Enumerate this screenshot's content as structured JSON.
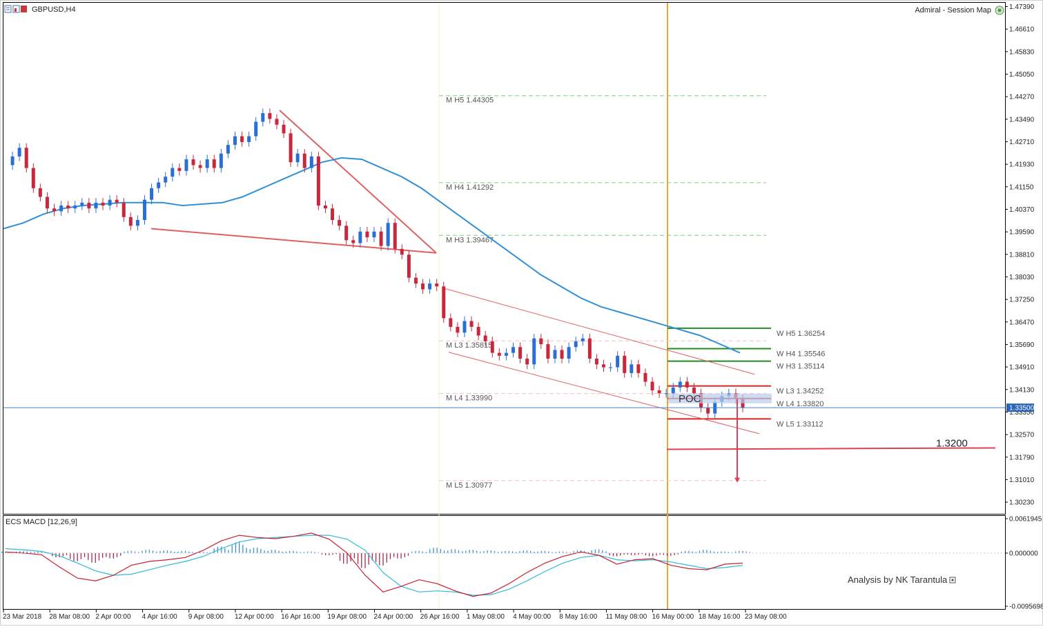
{
  "window": {
    "symbol_timeframe": "GBPUSD,H4",
    "session_map_label": "Admiral - Session Map",
    "analysis_credit": "Analysis by NK Tarantula"
  },
  "chart_data": [
    {
      "type": "candlestick",
      "title": "GBPUSD,H4",
      "x_tick_labels": [
        "23 Mar 2018",
        "28 Mar 08:00",
        "2 Apr 00:00",
        "4 Apr 16:00",
        "9 Apr 08:00",
        "12 Apr 00:00",
        "16 Apr 16:00",
        "19 Apr 08:00",
        "24 Apr 00:00",
        "26 Apr 16:00",
        "1 May 08:00",
        "4 May 00:00",
        "8 May 16:00",
        "11 May 08:00",
        "16 May 00:00",
        "18 May 16:00",
        "23 May 08:00"
      ],
      "y_tick_labels": [
        "1.47390",
        "1.46610",
        "1.45830",
        "1.45050",
        "1.44270",
        "1.43490",
        "1.42710",
        "1.41930",
        "1.41150",
        "1.40370",
        "1.39590",
        "1.38810",
        "1.38030",
        "1.37250",
        "1.36470",
        "1.35690",
        "1.34910",
        "1.34130",
        "1.33350",
        "1.32570",
        "1.31790",
        "1.31010",
        "1.30230"
      ],
      "ylim": [
        1.2985,
        1.4745
      ],
      "current_price": "1.33500",
      "price_path": [
        1.419,
        1.422,
        1.425,
        1.418,
        1.411,
        1.408,
        1.404,
        1.403,
        1.405,
        1.404,
        1.405,
        1.406,
        1.404,
        1.406,
        1.405,
        1.407,
        1.406,
        1.401,
        1.398,
        1.4,
        1.407,
        1.411,
        1.413,
        1.415,
        1.418,
        1.417,
        1.421,
        1.419,
        1.418,
        1.421,
        1.418,
        1.423,
        1.426,
        1.429,
        1.427,
        1.429,
        1.434,
        1.437,
        1.435,
        1.433,
        1.43,
        1.42,
        1.423,
        1.418,
        1.422,
        1.405,
        1.404,
        1.4,
        1.398,
        1.393,
        1.392,
        1.396,
        1.394,
        1.396,
        1.391,
        1.399,
        1.39,
        1.388,
        1.38,
        1.378,
        1.376,
        1.378,
        1.377,
        1.366,
        1.363,
        1.361,
        1.365,
        1.363,
        1.36,
        1.358,
        1.354,
        1.353,
        1.354,
        1.356,
        1.352,
        1.35,
        1.359,
        1.357,
        1.352,
        1.355,
        1.352,
        1.356,
        1.358,
        1.359,
        1.352,
        1.35,
        1.349,
        1.349,
        1.353,
        1.347,
        1.35,
        1.347,
        1.344,
        1.341,
        1.34,
        1.34,
        1.342,
        1.344,
        1.342,
        1.34,
        1.335,
        1.333,
        1.337,
        1.339,
        1.34,
        1.338,
        1.335
      ],
      "moving_average_path": [
        1.397,
        1.399,
        1.402,
        1.404,
        1.405,
        1.4055,
        1.406,
        1.406,
        1.406,
        1.405,
        1.4055,
        1.406,
        1.408,
        1.411,
        1.414,
        1.417,
        1.42,
        1.4215,
        1.421,
        1.418,
        1.415,
        1.411,
        1.406,
        1.401,
        1.396,
        1.391,
        1.386,
        1.381,
        1.377,
        1.373,
        1.37,
        1.368,
        1.366,
        1.364,
        1.362,
        1.36,
        1.357,
        1.354
      ],
      "monthly_levels": [
        {
          "label": "M  H5 1.44305",
          "value": 1.44305,
          "color": "#7ed07e"
        },
        {
          "label": "M  H4 1.41292",
          "value": 1.41292,
          "color": "#7ed07e"
        },
        {
          "label": "M  H3 1.39467",
          "value": 1.39467,
          "color": "#7ed07e"
        },
        {
          "label": "M  L3 1.35815",
          "value": 1.35815,
          "color": "#f0c0c0"
        },
        {
          "label": "M  L4 1.33990",
          "value": 1.3399,
          "color": "#f0c0c0"
        },
        {
          "label": "M  L5 1.30977",
          "value": 1.30977,
          "color": "#f0c0c0"
        }
      ],
      "weekly_levels": [
        {
          "label": "W  H5 1.36254",
          "value": 1.36254,
          "color": "#228b22"
        },
        {
          "label": "W  H4 1.35546",
          "value": 1.35546,
          "color": "#228b22"
        },
        {
          "label": "W  H3 1.35114",
          "value": 1.35114,
          "color": "#228b22"
        },
        {
          "label": "W  L3 1.34252",
          "value": 1.34252,
          "color": "#dd2222"
        },
        {
          "label": "W  L4 1.33820",
          "value": 1.3382,
          "color": "#dd2222"
        },
        {
          "label": "W  L5 1.33112",
          "value": 1.33112,
          "color": "#dd2222"
        }
      ],
      "annotations": {
        "poc_label": "POC",
        "target_label": "1.3200",
        "target_value": 1.3206
      }
    },
    {
      "type": "macd",
      "title": "ECS MACD [12,26,9]",
      "y_tick_labels": [
        "0.0061945",
        "0.000000",
        "-0.0095698"
      ],
      "ylim": [
        -0.0095698,
        0.0061945
      ],
      "histogram": [
        0.0003,
        0.0004,
        0.0003,
        -0.0008,
        -0.0015,
        -0.0018,
        -0.001,
        0.0004,
        0.0006,
        0.0005,
        0.0004,
        0.0002,
        0.0012,
        0.002,
        0.001,
        0.0006,
        0.0004,
        0.0003,
        -0.0004,
        -0.002,
        -0.0028,
        -0.0023,
        -0.001,
        0.0004,
        0.001,
        0.0007,
        0.0006,
        0.0005,
        0.0004,
        0.0005,
        0.0004,
        0.0003,
        0.0005,
        0.0007,
        -0.0006,
        -0.0004,
        -0.0006,
        -0.0005,
        0.0004,
        0.0006,
        0.0003,
        0.0004
      ],
      "macd_line": [
        0.0002,
        0.0,
        -0.0003,
        -0.0025,
        -0.0045,
        -0.005,
        -0.004,
        -0.0022,
        -0.0015,
        -0.0012,
        -0.0008,
        0.0005,
        0.0022,
        0.0032,
        0.0028,
        0.0026,
        0.003,
        0.0036,
        0.0025,
        0.0,
        -0.004,
        -0.007,
        -0.006,
        -0.0048,
        -0.0055,
        -0.0068,
        -0.0078,
        -0.0072,
        -0.0055,
        -0.0035,
        -0.0018,
        -0.0006,
        0.0002,
        -0.0004,
        -0.002,
        -0.0012,
        -0.001,
        -0.0022,
        -0.0028,
        -0.003,
        -0.002,
        -0.0018
      ],
      "signal_line": [
        0.0008,
        0.0006,
        0.0003,
        -0.0005,
        -0.0018,
        -0.0032,
        -0.004,
        -0.0038,
        -0.003,
        -0.0022,
        -0.0015,
        -0.0006,
        0.0008,
        0.002,
        0.0026,
        0.0028,
        0.003,
        0.0032,
        0.0032,
        0.0025,
        0.0005,
        -0.0035,
        -0.006,
        -0.007,
        -0.0068,
        -0.007,
        -0.0076,
        -0.0075,
        -0.0065,
        -0.005,
        -0.0033,
        -0.0018,
        -0.0008,
        -0.0004,
        -0.0012,
        -0.0014,
        -0.0012,
        -0.0016,
        -0.0022,
        -0.0028,
        -0.0026,
        -0.0022
      ]
    }
  ]
}
